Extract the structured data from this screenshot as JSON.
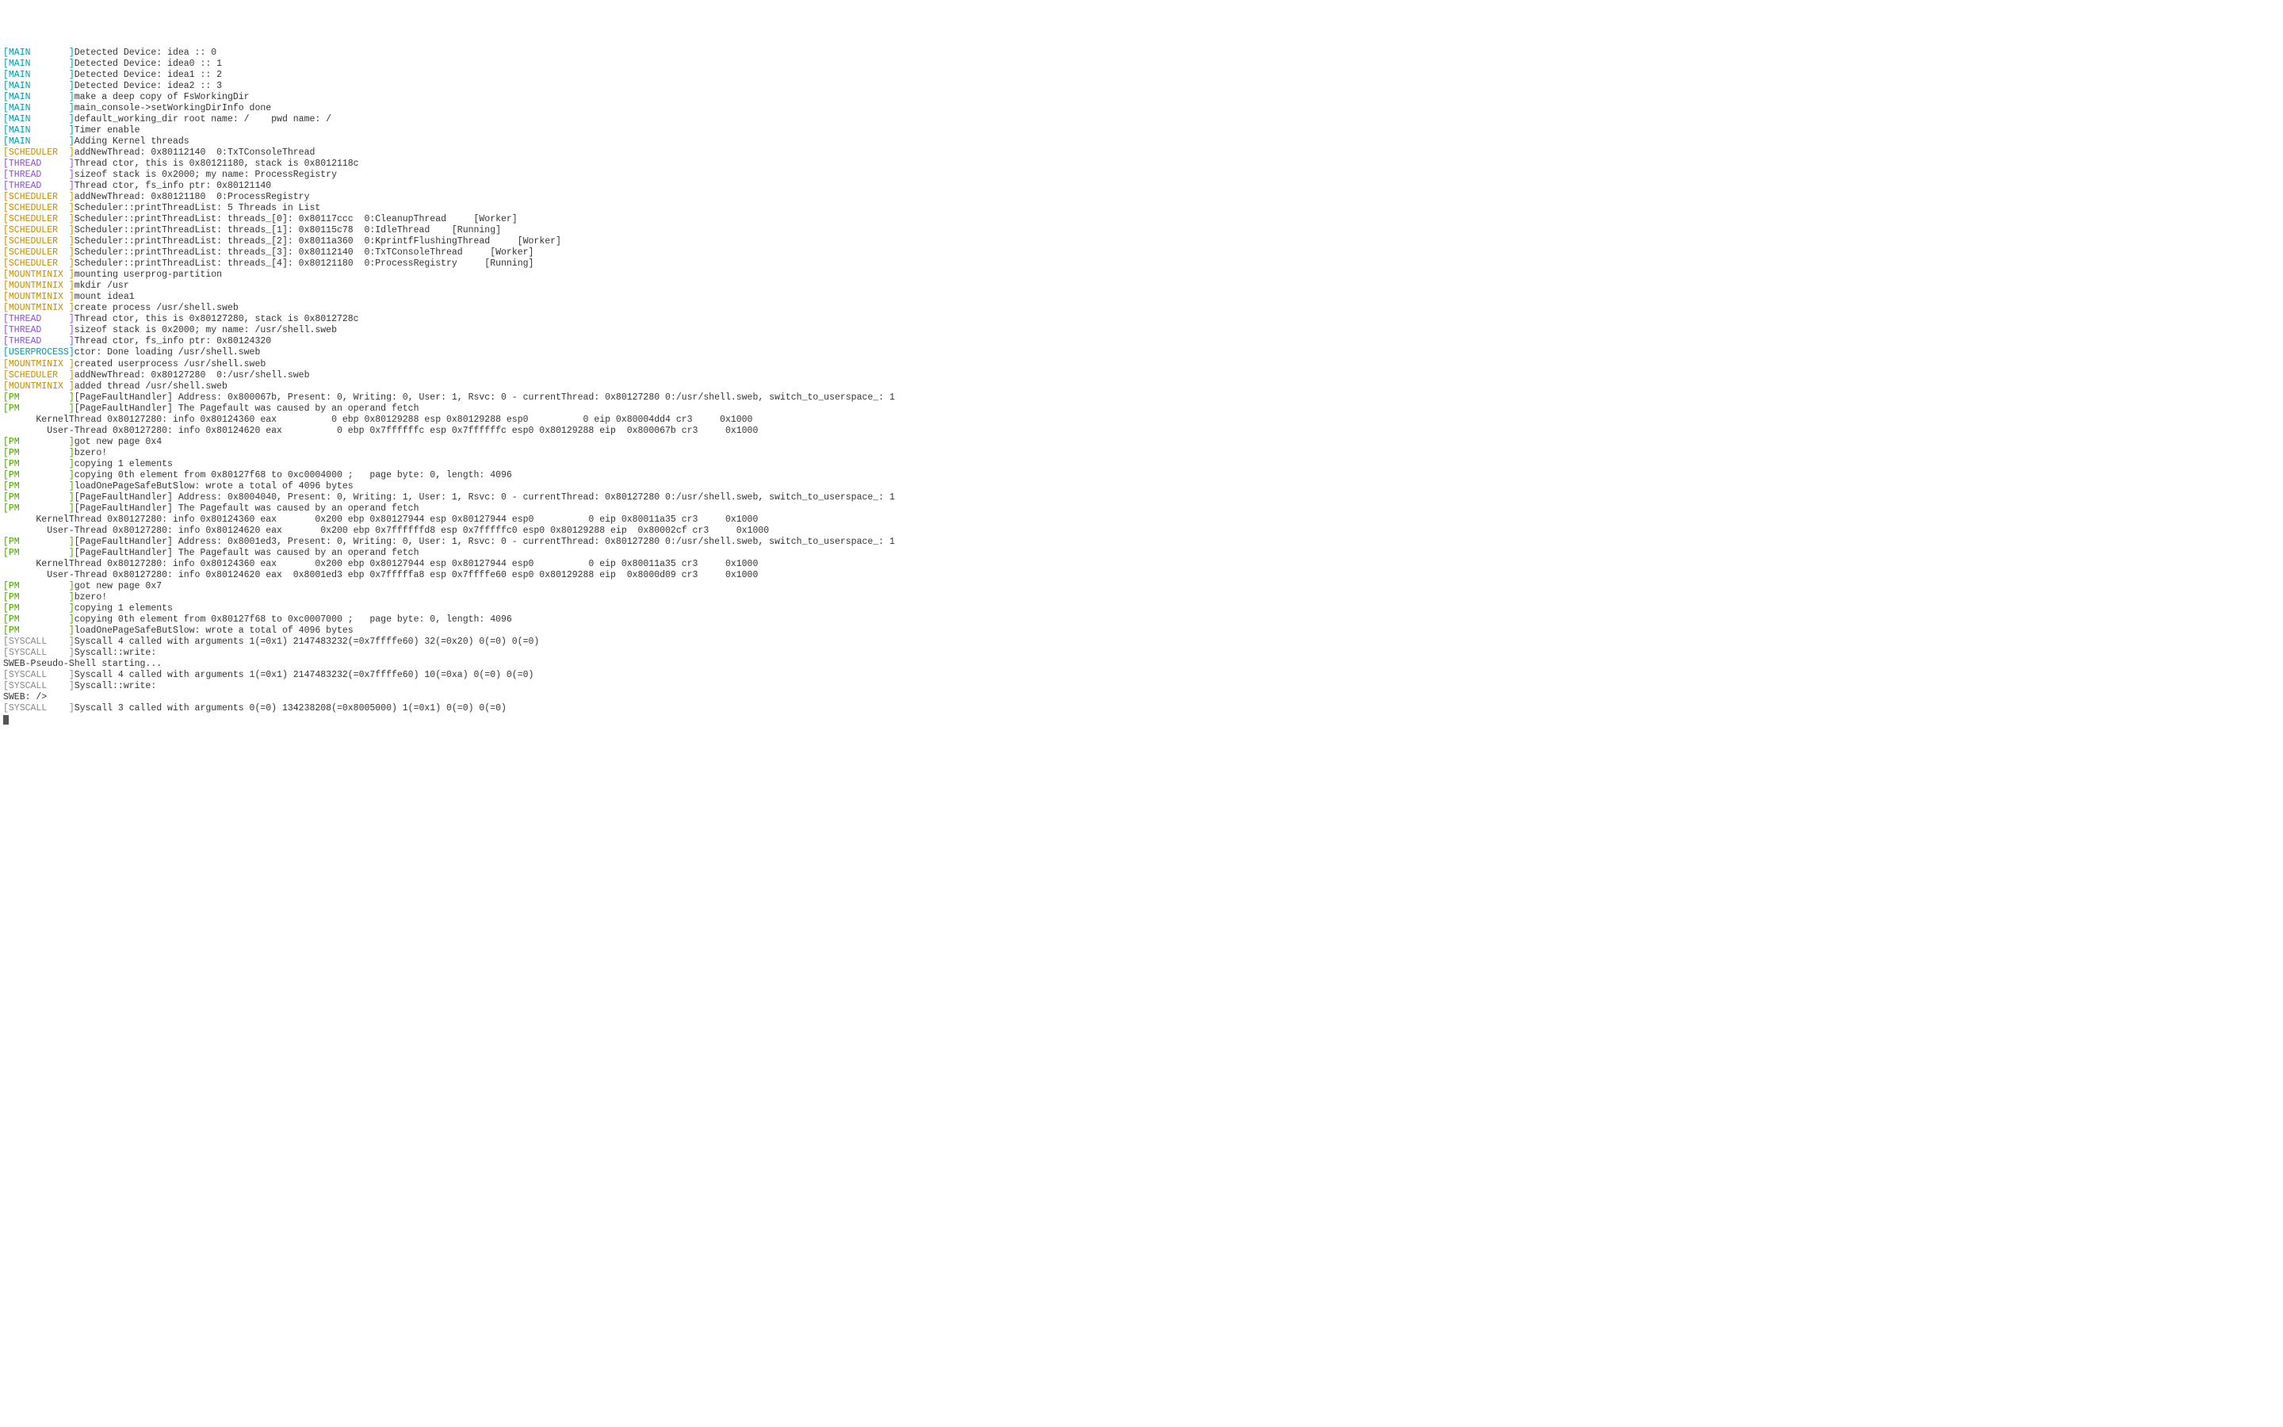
{
  "colors": {
    "MAIN": "c-teal",
    "SCHEDULER": "c-orange",
    "THREAD": "c-purple",
    "MOUNTMINIX": "c-orange",
    "USERPROCESS": "c-teal",
    "PM": "c-green",
    "SYSCALL": "c-gray"
  },
  "tagWidth": 11,
  "lines": [
    {
      "tag": "MAIN",
      "msg": "Detected Device: idea :: 0"
    },
    {
      "tag": "MAIN",
      "msg": "Detected Device: idea0 :: 1"
    },
    {
      "tag": "MAIN",
      "msg": "Detected Device: idea1 :: 2"
    },
    {
      "tag": "MAIN",
      "msg": "Detected Device: idea2 :: 3"
    },
    {
      "tag": "MAIN",
      "msg": "make a deep copy of FsWorkingDir"
    },
    {
      "tag": "MAIN",
      "msg": "main_console->setWorkingDirInfo done"
    },
    {
      "tag": "MAIN",
      "msg": "default_working_dir root name: /    pwd name: /"
    },
    {
      "tag": "MAIN",
      "msg": "Timer enable"
    },
    {
      "tag": "MAIN",
      "msg": "Adding Kernel threads"
    },
    {
      "tag": "SCHEDULER",
      "msg": "addNewThread: 0x80112140  0:TxTConsoleThread"
    },
    {
      "tag": "THREAD",
      "msg": "Thread ctor, this is 0x80121180, stack is 0x8012118c"
    },
    {
      "tag": "THREAD",
      "msg": "sizeof stack is 0x2000; my name: ProcessRegistry"
    },
    {
      "tag": "THREAD",
      "msg": "Thread ctor, fs_info ptr: 0x80121140"
    },
    {
      "tag": "SCHEDULER",
      "msg": "addNewThread: 0x80121180  0:ProcessRegistry"
    },
    {
      "tag": "SCHEDULER",
      "msg": "Scheduler::printThreadList: 5 Threads in List"
    },
    {
      "tag": "SCHEDULER",
      "msg": "Scheduler::printThreadList: threads_[0]: 0x80117ccc  0:CleanupThread     [Worker]"
    },
    {
      "tag": "SCHEDULER",
      "msg": "Scheduler::printThreadList: threads_[1]: 0x80115c78  0:IdleThread    [Running]"
    },
    {
      "tag": "SCHEDULER",
      "msg": "Scheduler::printThreadList: threads_[2]: 0x8011a360  0:KprintfFlushingThread     [Worker]"
    },
    {
      "tag": "SCHEDULER",
      "msg": "Scheduler::printThreadList: threads_[3]: 0x80112140  0:TxTConsoleThread     [Worker]"
    },
    {
      "tag": "SCHEDULER",
      "msg": "Scheduler::printThreadList: threads_[4]: 0x80121180  0:ProcessRegistry     [Running]"
    },
    {
      "tag": "MOUNTMINIX",
      "msg": "mounting userprog-partition"
    },
    {
      "tag": "MOUNTMINIX",
      "msg": "mkdir /usr"
    },
    {
      "tag": "MOUNTMINIX",
      "msg": "mount idea1"
    },
    {
      "tag": "MOUNTMINIX",
      "msg": "create process /usr/shell.sweb"
    },
    {
      "tag": "THREAD",
      "msg": "Thread ctor, this is 0x80127280, stack is 0x8012728c"
    },
    {
      "tag": "THREAD",
      "msg": "sizeof stack is 0x2000; my name: /usr/shell.sweb"
    },
    {
      "tag": "THREAD",
      "msg": "Thread ctor, fs_info ptr: 0x80124320"
    },
    {
      "tag": "USERPROCESS",
      "msg": "ctor: Done loading /usr/shell.sweb"
    },
    {
      "tag": "MOUNTMINIX",
      "msg": "created userprocess /usr/shell.sweb"
    },
    {
      "tag": "SCHEDULER",
      "msg": "addNewThread: 0x80127280  0:/usr/shell.sweb"
    },
    {
      "tag": "MOUNTMINIX",
      "msg": "added thread /usr/shell.sweb"
    },
    {
      "tag": "PM",
      "msg": "[PageFaultHandler] Address: 0x800067b, Present: 0, Writing: 0, User: 1, Rsvc: 0 - currentThread: 0x80127280 0:/usr/shell.sweb, switch_to_userspace_: 1"
    },
    {
      "tag": "PM",
      "msg": "[PageFaultHandler] The Pagefault was caused by an operand fetch"
    },
    {
      "plain": "      KernelThread 0x80127280: info 0x80124360 eax          0 ebp 0x80129288 esp 0x80129288 esp0          0 eip 0x80004dd4 cr3     0x1000"
    },
    {
      "plain": "        User-Thread 0x80127280: info 0x80124620 eax          0 ebp 0x7ffffffc esp 0x7ffffffc esp0 0x80129288 eip  0x800067b cr3     0x1000"
    },
    {
      "tag": "PM",
      "msg": "got new page 0x4"
    },
    {
      "tag": "PM",
      "msg": "bzero!"
    },
    {
      "tag": "PM",
      "msg": "copying 1 elements"
    },
    {
      "tag": "PM",
      "msg": "copying 0th element from 0x80127f68 to 0xc0004000 ;   page byte: 0, length: 4096"
    },
    {
      "tag": "PM",
      "msg": "loadOnePageSafeButSlow: wrote a total of 4096 bytes"
    },
    {
      "tag": "PM",
      "msg": "[PageFaultHandler] Address: 0x8004040, Present: 0, Writing: 1, User: 1, Rsvc: 0 - currentThread: 0x80127280 0:/usr/shell.sweb, switch_to_userspace_: 1"
    },
    {
      "tag": "PM",
      "msg": "[PageFaultHandler] The Pagefault was caused by an operand fetch"
    },
    {
      "plain": "      KernelThread 0x80127280: info 0x80124360 eax       0x200 ebp 0x80127944 esp 0x80127944 esp0          0 eip 0x80011a35 cr3     0x1000"
    },
    {
      "plain": "        User-Thread 0x80127280: info 0x80124620 eax       0x200 ebp 0x7ffffffd8 esp 0x7fffffc0 esp0 0x80129288 eip  0x80002cf cr3     0x1000"
    },
    {
      "tag": "PM",
      "msg": "[PageFaultHandler] Address: 0x8001ed3, Present: 0, Writing: 0, User: 1, Rsvc: 0 - currentThread: 0x80127280 0:/usr/shell.sweb, switch_to_userspace_: 1"
    },
    {
      "tag": "PM",
      "msg": "[PageFaultHandler] The Pagefault was caused by an operand fetch"
    },
    {
      "plain": "      KernelThread 0x80127280: info 0x80124360 eax       0x200 ebp 0x80127944 esp 0x80127944 esp0          0 eip 0x80011a35 cr3     0x1000"
    },
    {
      "plain": "        User-Thread 0x80127280: info 0x80124620 eax  0x8001ed3 ebp 0x7fffffa8 esp 0x7ffffe60 esp0 0x80129288 eip  0x8000d09 cr3     0x1000"
    },
    {
      "tag": "PM",
      "msg": "got new page 0x7"
    },
    {
      "tag": "PM",
      "msg": "bzero!"
    },
    {
      "tag": "PM",
      "msg": "copying 1 elements"
    },
    {
      "tag": "PM",
      "msg": "copying 0th element from 0x80127f68 to 0xc0007000 ;   page byte: 0, length: 4096"
    },
    {
      "tag": "PM",
      "msg": "loadOnePageSafeButSlow: wrote a total of 4096 bytes"
    },
    {
      "tag": "SYSCALL",
      "msg": "Syscall 4 called with arguments 1(=0x1) 2147483232(=0x7ffffe60) 32(=0x20) 0(=0) 0(=0)"
    },
    {
      "tag": "SYSCALL",
      "msg": "Syscall::write:"
    },
    {
      "plain": "SWEB-Pseudo-Shell starting..."
    },
    {
      "plain": ""
    },
    {
      "tag": "SYSCALL",
      "msg": "Syscall 4 called with arguments 1(=0x1) 2147483232(=0x7ffffe60) 10(=0xa) 0(=0) 0(=0)"
    },
    {
      "tag": "SYSCALL",
      "msg": "Syscall::write:"
    },
    {
      "plain": "SWEB: />"
    },
    {
      "tag": "SYSCALL",
      "msg": "Syscall 3 called with arguments 0(=0) 134238208(=0x8005000) 1(=0x1) 0(=0) 0(=0)"
    }
  ],
  "cursor": true
}
